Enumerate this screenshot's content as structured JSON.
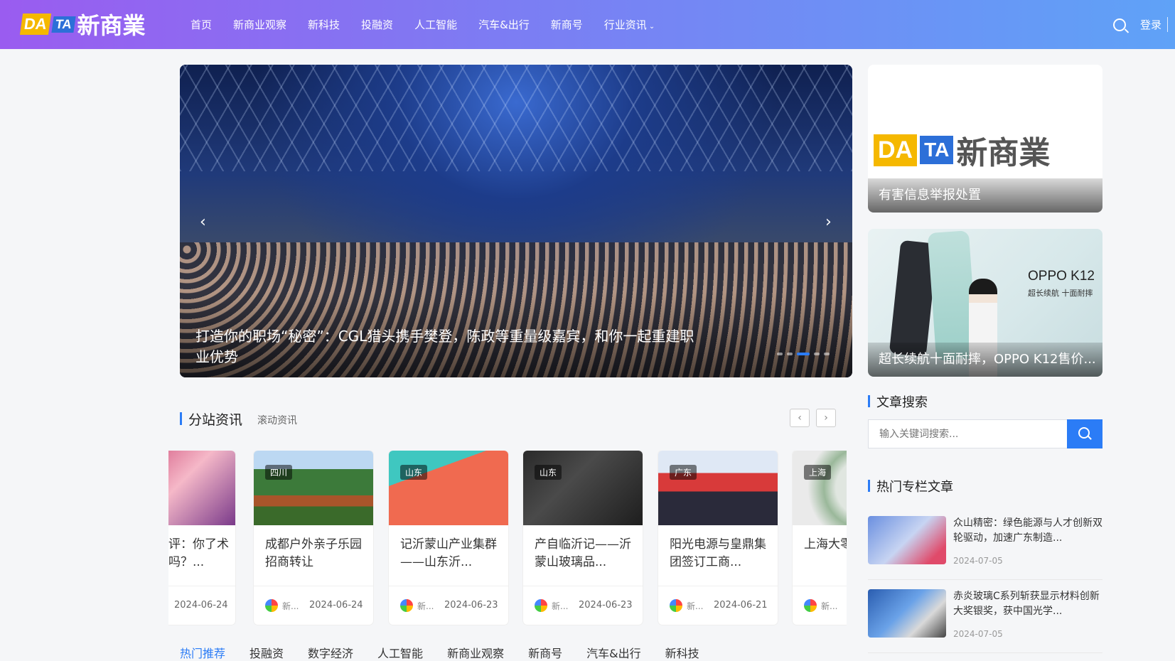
{
  "header": {
    "logo": {
      "da": "DA",
      "ta": "TA",
      "cn": "新商業"
    },
    "nav": [
      "首页",
      "新商业观察",
      "新科技",
      "投融资",
      "人工智能",
      "汽车&出行",
      "新商号",
      "行业资讯"
    ],
    "login": "登录"
  },
  "slider": {
    "caption": "打造你的职场“秘密”：CGL猎头携手樊登，陈政等重量级嘉宾，和你一起重建职业优势"
  },
  "side": {
    "card1": {
      "caption": "有害信息举报处置",
      "logo_da": "DA",
      "logo_ta": "TA",
      "logo_cn": "新商業"
    },
    "card2": {
      "caption": "超长续航十面耐摔，OPPO K12售价...",
      "brand": "OPPO K12",
      "sub": "超长续航 十面耐摔"
    }
  },
  "search": {
    "title": "文章搜索",
    "placeholder": "输入关键词搜索..."
  },
  "hot": {
    "title": "热门专栏文章",
    "items": [
      {
        "title": "众山精密：绿色能源与人才创新双轮驱动，加速广东制造...",
        "date": "2024-07-05"
      },
      {
        "title": "赤炎玻璃C系列斩获显示材料创新大奖银奖，获中国光学...",
        "date": "2024-07-05"
      }
    ]
  },
  "branch": {
    "title": "分站资讯",
    "sub": "滚动资讯",
    "prev": "‹",
    "next": "›",
    "cards": [
      {
        "tag": "",
        "title": "评：你了术吗？...",
        "author": "",
        "date": "2024-06-24"
      },
      {
        "tag": "四川",
        "title": "成都户外亲子乐园招商转让",
        "author": "新...",
        "date": "2024-06-24"
      },
      {
        "tag": "山东",
        "title": "记沂蒙山产业集群——山东沂...",
        "author": "新...",
        "date": "2024-06-23"
      },
      {
        "tag": "山东",
        "title": "产自临沂记——沂蒙山玻璃品...",
        "author": "新...",
        "date": "2024-06-23"
      },
      {
        "tag": "广东",
        "title": "阳光电源与皇鼎集团签订工商...",
        "author": "新...",
        "date": "2024-06-21"
      },
      {
        "tag": "上海",
        "title": "上海大零加速迈向",
        "author": "新...",
        "date": ""
      }
    ]
  },
  "bottom_tabs": [
    "热门推荐",
    "投融资",
    "数字经济",
    "人工智能",
    "新商业观察",
    "新商号",
    "汽车&出行",
    "新科技"
  ],
  "colors": {
    "accent": "#2b7cf6",
    "header_start": "#9a5cf0",
    "header_end": "#5fa2f7"
  }
}
